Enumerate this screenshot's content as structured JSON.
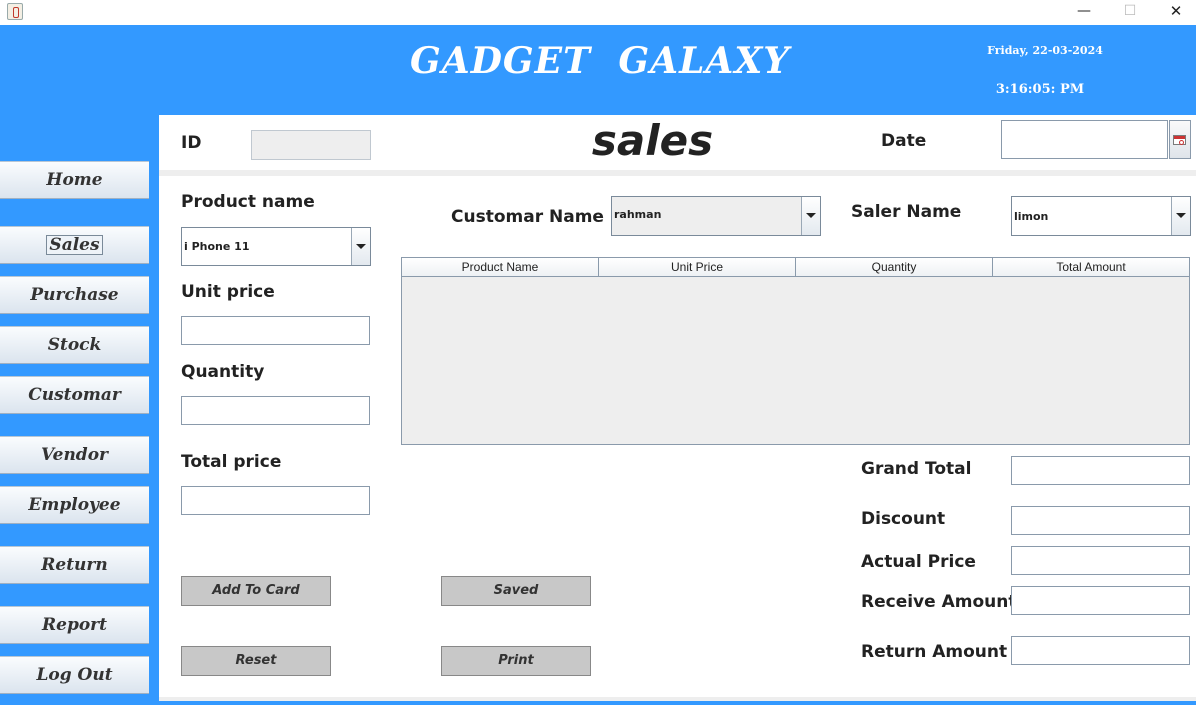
{
  "window": {
    "minimize_glyph": "—",
    "maximize_glyph": "☐",
    "close_glyph": "✕"
  },
  "header": {
    "title": "GADGET  GALAXY",
    "date": "Friday, 22-03-2024",
    "time": "3:16:05: PM",
    "background_color": "#3399ff"
  },
  "sidebar": {
    "items": [
      {
        "label": "Home"
      },
      {
        "label": "Sales"
      },
      {
        "label": "Purchase"
      },
      {
        "label": "Stock"
      },
      {
        "label": "Customar"
      },
      {
        "label": "Vendor"
      },
      {
        "label": "Employee"
      },
      {
        "label": "Return"
      },
      {
        "label": "Report"
      },
      {
        "label": "Log Out"
      }
    ],
    "active": "Sales"
  },
  "form": {
    "id_label": "ID",
    "id_value": "",
    "title": "sales",
    "date_label": "Date",
    "date_value": "",
    "product_name_label": "Product name",
    "product_name_value": "i Phone 11",
    "unit_price_label": "Unit price",
    "unit_price_value": "",
    "quantity_label": "Quantity",
    "quantity_value": "",
    "total_price_label": "Total price",
    "total_price_value": "",
    "customer_name_label": "Customar Name",
    "customer_name_value": "rahman",
    "saler_name_label": "Saler Name",
    "saler_name_value": "limon"
  },
  "table": {
    "columns": [
      "Product Name",
      "Unit Price",
      "Quantity",
      "Total Amount"
    ],
    "rows": []
  },
  "totals": {
    "grand_total_label": "Grand Total",
    "grand_total_value": "",
    "discount_label": "Discount",
    "discount_value": "",
    "actual_price_label": "Actual Price",
    "actual_price_value": "",
    "receive_amount_label": "Receive Amount",
    "receive_amount_value": "",
    "return_amount_label": "Return Amount",
    "return_amount_value": ""
  },
  "actions": {
    "add_to_card": "Add To Card",
    "saved": "Saved",
    "reset": "Reset",
    "print": "Print"
  },
  "icons": {
    "app": "java-cup-icon",
    "date_picker": "calendar-icon",
    "dropdown": "chevron-down-icon"
  }
}
